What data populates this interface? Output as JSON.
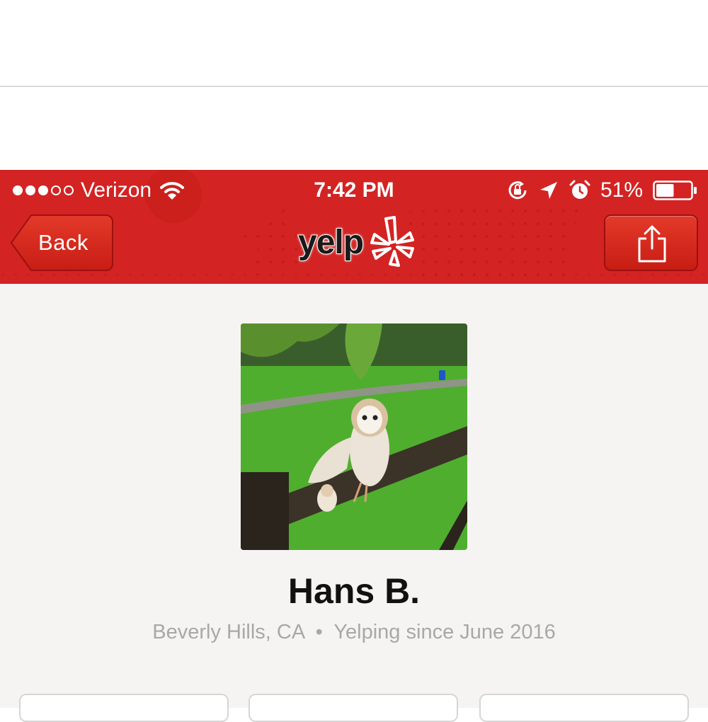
{
  "status_bar": {
    "signal_filled": 3,
    "signal_total": 5,
    "carrier": "Verizon",
    "time": "7:42 PM",
    "battery_percent": "51%",
    "battery_level": 0.51,
    "icons": [
      "signal-dots",
      "wifi-icon",
      "orientation-lock-icon",
      "location-arrow-icon",
      "alarm-icon",
      "battery-icon"
    ]
  },
  "nav": {
    "back_label": "Back",
    "logo_text": "yelp",
    "share_icon": "share-icon"
  },
  "profile": {
    "name": "Hans B.",
    "location": "Beverly Hills, CA",
    "separator": "•",
    "member_since": "Yelping since June 2016",
    "photo": "owl-on-fence"
  },
  "colors": {
    "brand_red": "#d32323",
    "background": "#f5f4f2",
    "meta_gray": "#a8a8a8"
  }
}
